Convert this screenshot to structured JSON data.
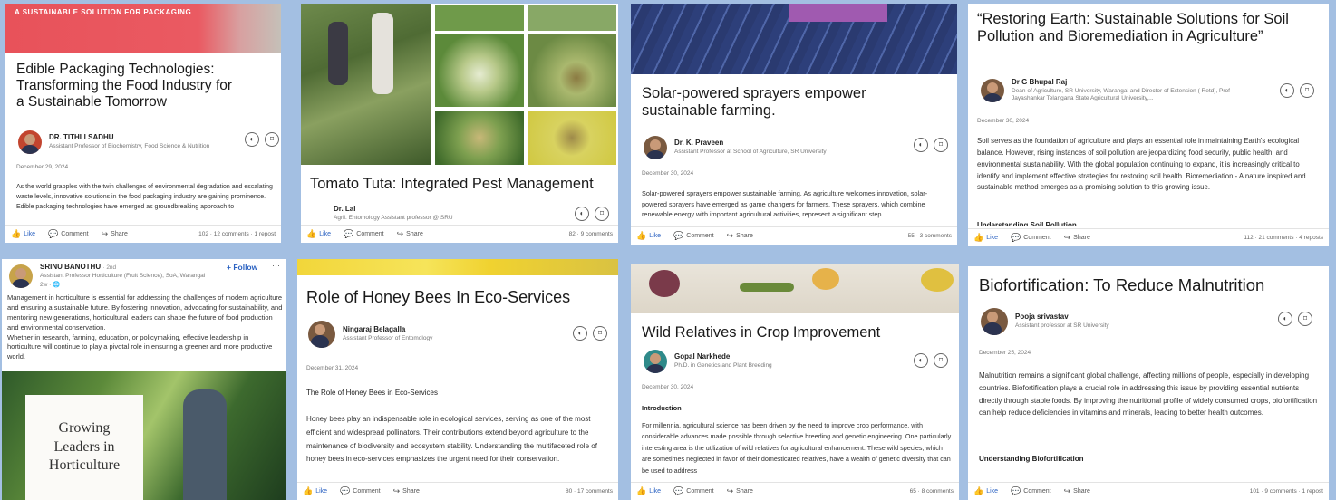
{
  "cards": [
    {
      "banner": "A SUSTAINABLE SOLUTION FOR PACKAGING",
      "title": "Edible Packaging Technologies: Transforming the Food Industry for a Sustainable Tomorrow",
      "author": "DR. TITHLI SADHU",
      "role": "Assistant Professor of Biochemistry, Food Science & Nutrition",
      "date": "December 29, 2024",
      "body": "As the world grapples with the twin challenges of environmental degradation and escalating waste levels, innovative solutions in the food packaging industry are gaining prominence. Edible packaging technologies have emerged as groundbreaking approach to",
      "stats": "102 · 12 comments · 1 repost"
    },
    {
      "title": "Tomato Tuta: Integrated Pest Management",
      "author": "Dr. Lal",
      "role": "Agril. Entomology Assistant professor @ SRU",
      "stats": "82 · 9 comments"
    },
    {
      "title": "Solar-powered sprayers empower sustainable farming.",
      "author": "Dr. K. Praveen",
      "role": "Assistant Professor at School of Agriculture, SR University",
      "date": "December 30, 2024",
      "body": "Solar-powered sprayers empower sustainable farming. As agriculture welcomes innovation, solar-powered sprayers have emerged as game changers for farmers. These sprayers, which combine renewable energy with important agricultural activities, represent a significant step",
      "stats": "55 · 3 comments"
    },
    {
      "title": "“Restoring Earth: Sustainable Solutions for Soil Pollution and Bioremediation in Agriculture”",
      "author": "Dr G Bhupal Raj",
      "role": "Dean of Agriculture, SR University, Warangal and Director of Extension ( Retd), Prof Jayashankar Telangana State Agricultural University,...",
      "date": "December 30, 2024",
      "body": "Soil serves as the foundation of agriculture and plays an essential role in maintaining Earth's ecological balance. However, rising instances of soil pollution are jeopardizing food security, public health, and environmental sustainability. With the global population continuing to expand, it is increasingly critical to identify and implement effective strategies for restoring soil health. Bioremediation - A nature inspired and sustainable method emerges as a promising solution to this growing issue.",
      "section": "Understanding Soil Pollution",
      "stats": "112 · 21 comments · 4 reposts"
    },
    {
      "author": "SRINU BANOTHU",
      "degree": "· 2nd",
      "role": "Assistant Professor Horticulture (Fruit Science), SoA, Warangal",
      "time": "2w ·",
      "follow": "+ Follow",
      "more": "···",
      "body1": "Management in horticulture is essential for addressing the challenges of modern agriculture and ensuring a sustainable future. By fostering innovation, advocating for sustainability, and mentoring new generations, horticultural leaders can shape the future of food production and environmental conservation.",
      "body2": "Whether in research, farming, education, or policymaking, effective leadership in horticulture will continue to play a pivotal role in ensuring a greener and more productive world.",
      "image_text": "Growing Leaders in Horticulture"
    },
    {
      "title": "Role of Honey Bees In Eco-Services",
      "author": "Ningaraj Belagalla",
      "role": "Assistant Professor of Entomology",
      "date": "December 31, 2024",
      "section": "The Role of Honey Bees in Eco-Services",
      "body": "Honey bees play an indispensable role in ecological services, serving as one of the most efficient and widespread pollinators. Their contributions extend beyond agriculture to the maintenance of biodiversity and ecosystem stability. Understanding the multifaceted role of honey bees in eco-services emphasizes the urgent need for their conservation.",
      "stats": "80 · 17 comments"
    },
    {
      "title": "Wild Relatives in Crop Improvement",
      "author": "Gopal Narkhede",
      "role": "Ph.D. in Genetics and Plant Breeding",
      "date": "December 30, 2024",
      "section": "Introduction",
      "body": "For millennia, agricultural science has been driven by the need to improve crop performance, with considerable advances made possible through selective breeding and genetic engineering. One particularly interesting area is the utilization of wild relatives for agricultural enhancement. These wild species, which are sometimes neglected in favor of their domesticated relatives, have a wealth of genetic diversity that can be used to address",
      "stats": "65 · 8 comments"
    },
    {
      "title": "Biofortification: To Reduce Malnutrition",
      "author": "Pooja srivastav",
      "role": "Assistant professor at SR University",
      "date": "December 25, 2024",
      "body": "Malnutrition remains a significant global challenge, affecting millions of people, especially in developing countries. Biofortification plays a crucial role in addressing this issue by providing essential nutrients directly through staple foods. By improving the nutritional profile of widely consumed crops, biofortification can help reduce deficiencies in vitamins and minerals, leading to better health outcomes.",
      "section": "Understanding Biofortification",
      "stats": "101 · 9 comments · 1 repost"
    }
  ],
  "actions": {
    "like": "Like",
    "comment": "Comment",
    "share": "Share"
  },
  "colors": {
    "background": "#a3bfe2",
    "accent": "#2b62c2",
    "banner_red": "#e8525a"
  }
}
